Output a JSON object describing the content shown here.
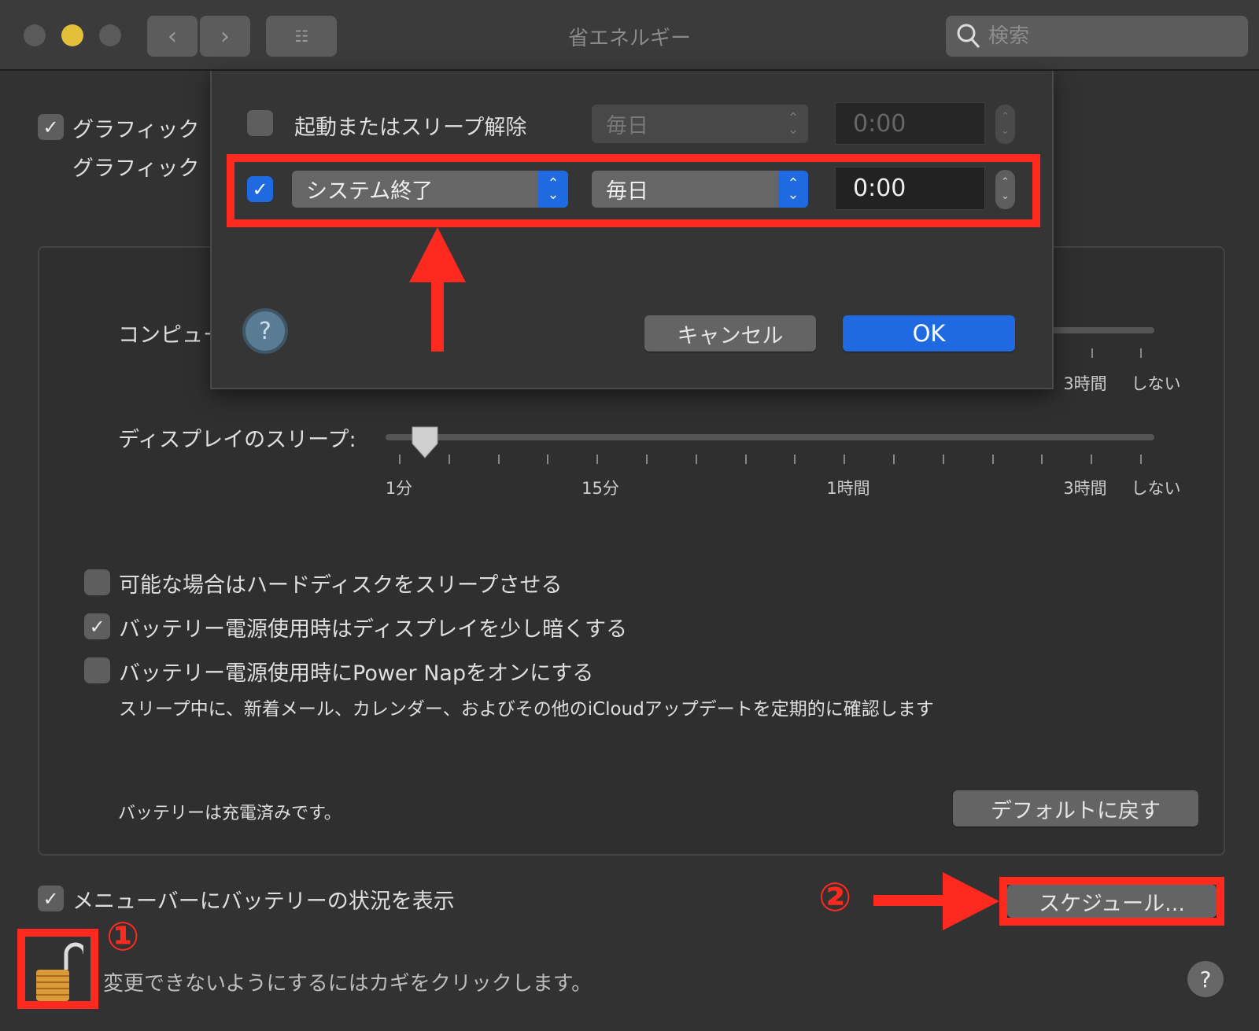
{
  "window": {
    "title": "省エネルギー",
    "search_placeholder": "検索"
  },
  "background": {
    "graphics_switch_label": "グラフィック",
    "graphics_sub_label": "グラフィック",
    "computer_sleep_label": "コンピュータのスリープ:",
    "display_sleep_label": "ディスプレイのスリープ:",
    "display_sleep_ticks": [
      "1分",
      "15分",
      "1時間",
      "3時間",
      "しない"
    ],
    "computer_sleep_ticks": [
      "3時間",
      "しない"
    ],
    "display_sleep_position_tick": 1,
    "options": [
      {
        "label": "可能な場合はハードディスクをスリープさせる",
        "checked": false
      },
      {
        "label": "バッテリー電源使用時はディスプレイを少し暗くする",
        "checked": true
      },
      {
        "label": "バッテリー電源使用時にPower Napをオンにする",
        "checked": false
      }
    ],
    "power_nap_description": "スリープ中に、新着メール、カレンダー、およびその他のiCloudアップデートを定期的に確認します",
    "battery_status": "バッテリーは充電済みです。",
    "restore_defaults": "デフォルトに戻す",
    "menu_bar_label": "メニューバーにバッテリーの状況を表示",
    "schedule_button": "スケジュール...",
    "lock_text": "変更できないようにするにはカギをクリックします。",
    "help": "?"
  },
  "dialog": {
    "row1": {
      "label": "起動またはスリープ解除",
      "checked": false,
      "frequency": "毎日",
      "time": "0:00"
    },
    "row2": {
      "action": "システム終了",
      "checked": true,
      "frequency": "毎日",
      "time": "0:00"
    },
    "help": "?",
    "cancel": "キャンセル",
    "ok": "OK"
  },
  "annotations": {
    "step1": "①",
    "step2": "②"
  },
  "colors": {
    "accent": "#1f6ae0",
    "annotation": "#ff2a1f"
  }
}
